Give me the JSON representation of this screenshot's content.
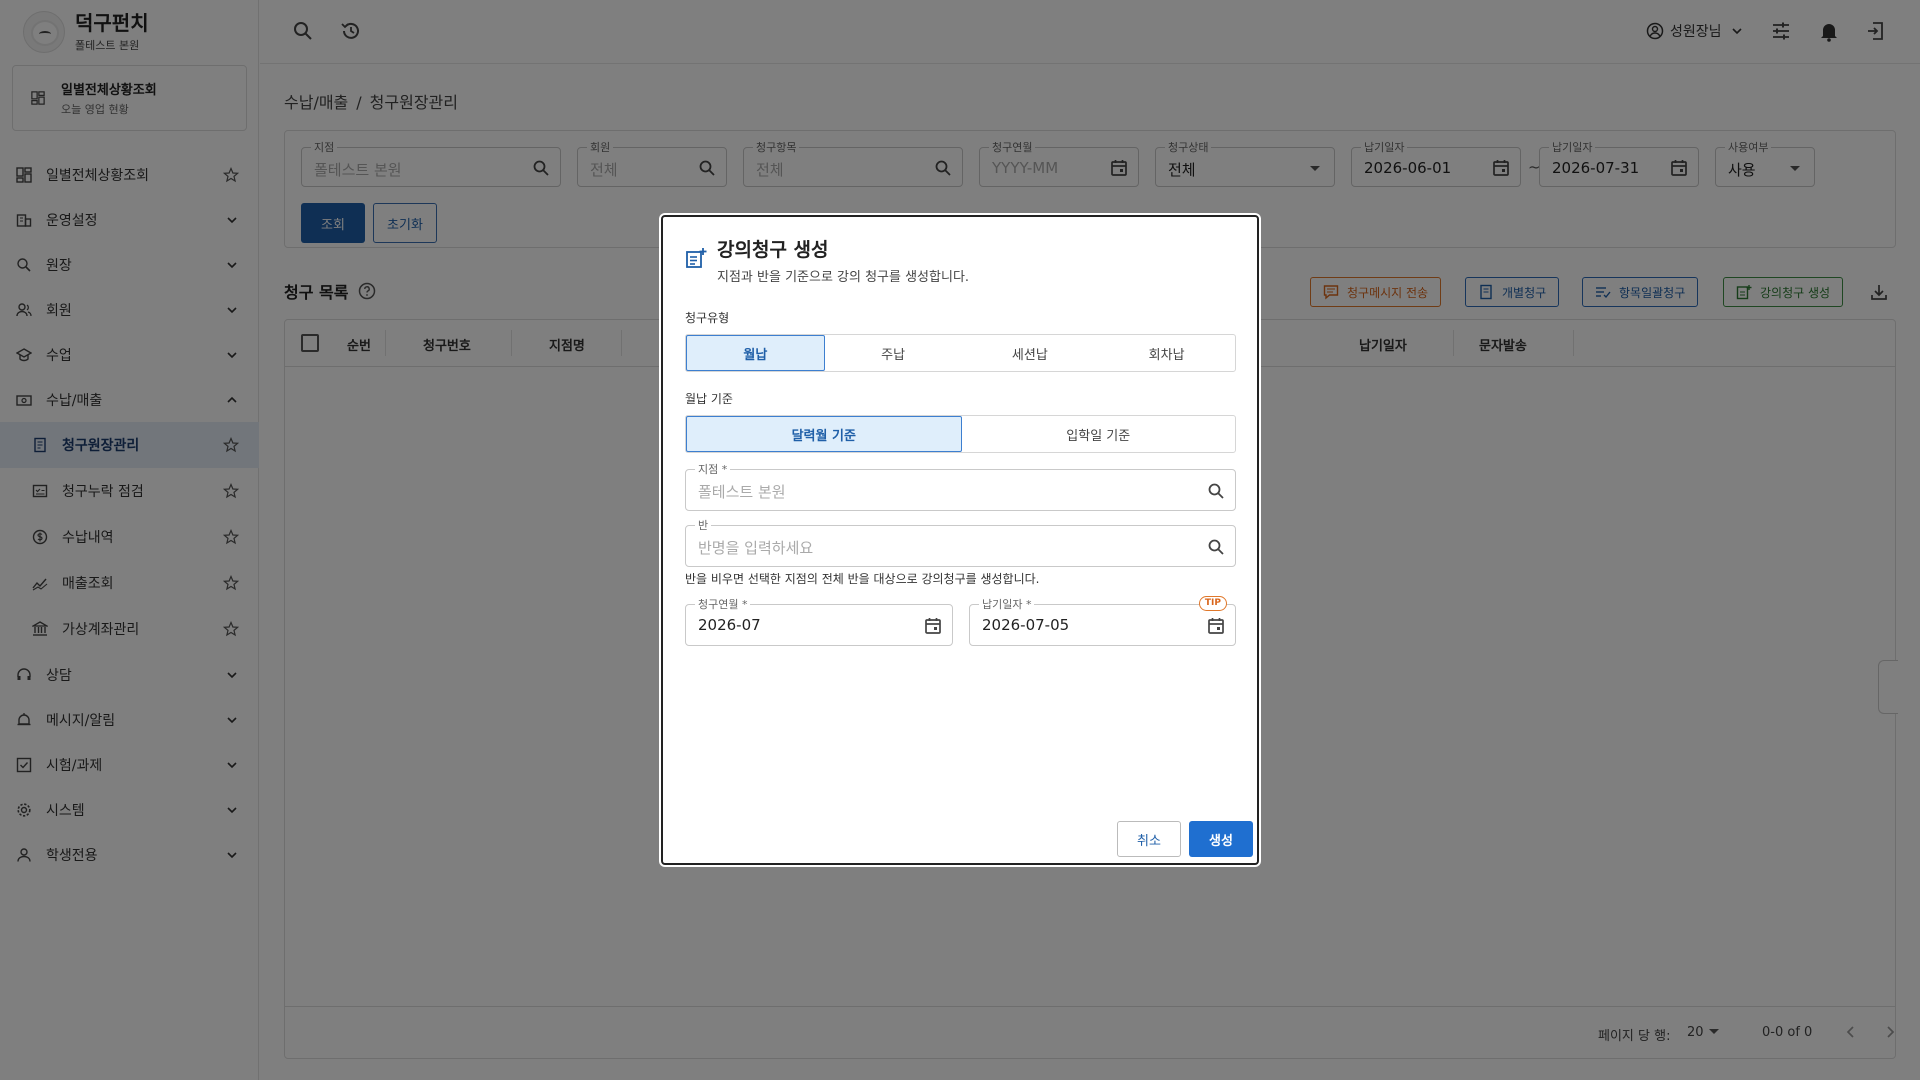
{
  "brand": {
    "title": "덕구펀치",
    "subtitle": "폴테스트 본원"
  },
  "summary_card": {
    "title": "일별전체상황조회",
    "subtitle": "오늘 영업 현황"
  },
  "sidebar": {
    "items": [
      {
        "label": "일별전체상황조회",
        "icon": "dashboard-icon",
        "trail": "star"
      },
      {
        "label": "운영설정",
        "icon": "building-icon",
        "trail": "chevron-down"
      },
      {
        "label": "원장",
        "icon": "user-search-icon",
        "trail": "chevron-down"
      },
      {
        "label": "회원",
        "icon": "users-icon",
        "trail": "chevron-down"
      },
      {
        "label": "수업",
        "icon": "school-icon",
        "trail": "chevron-down"
      },
      {
        "label": "수납/매출",
        "icon": "money-icon",
        "trail": "chevron-up"
      }
    ],
    "subitems": [
      {
        "label": "청구원장관리",
        "icon": "ledger-icon",
        "active": true
      },
      {
        "label": "청구누락 점검",
        "icon": "check-list-icon",
        "active": false
      },
      {
        "label": "수납내역",
        "icon": "coin-icon",
        "active": false
      },
      {
        "label": "매출조회",
        "icon": "chart-icon",
        "active": false
      },
      {
        "label": "가상계좌관리",
        "icon": "bank-icon",
        "active": false
      }
    ],
    "items_after": [
      {
        "label": "상담",
        "icon": "headset-icon"
      },
      {
        "label": "메시지/알림",
        "icon": "alarm-icon"
      },
      {
        "label": "시험/과제",
        "icon": "checkbox-icon"
      },
      {
        "label": "시스템",
        "icon": "gear-icon"
      },
      {
        "label": "학생전용",
        "icon": "person-icon"
      }
    ]
  },
  "topbar": {
    "user": "성원장님"
  },
  "breadcrumb": {
    "parent": "수납/매출",
    "sep": "/",
    "current": "청구원장관리"
  },
  "filters": {
    "branch": {
      "label": "지점",
      "placeholder": "폴테스트 본원"
    },
    "member": {
      "label": "회원",
      "placeholder": "전체"
    },
    "item": {
      "label": "청구항목",
      "placeholder": "전체"
    },
    "month": {
      "label": "청구연월",
      "placeholder": "YYYY-MM"
    },
    "status": {
      "label": "청구상태",
      "value": "전체"
    },
    "due_from": {
      "label": "납기일자",
      "value": "2026-06-01"
    },
    "tilde": "~",
    "due_to": {
      "label": "납기일자",
      "value": "2026-07-31"
    },
    "use": {
      "label": "사용여부",
      "value": "사용"
    },
    "query_label": "조회",
    "reset_label": "초기화"
  },
  "list": {
    "title": "청구 목록",
    "actions": {
      "message": "청구메시지 전송",
      "individual": "개별청구",
      "bulk": "항목일괄청구",
      "lecture": "강의청구 생성"
    },
    "columns": [
      "순번",
      "청구번호",
      "지점명",
      "납기일자",
      "문자발송"
    ],
    "footer": {
      "rows_per_page_label": "페이지 당 행:",
      "rows_per_page": "20",
      "range": "0-0 of 0"
    }
  },
  "modal": {
    "title": "강의청구 생성",
    "subtitle": "지점과 반을 기준으로 강의 청구를 생성합니다.",
    "type_label": "청구유형",
    "types": [
      "월납",
      "주납",
      "세션납",
      "회차납"
    ],
    "type_selected": 0,
    "basis_label": "월납 기준",
    "bases": [
      "달력월 기준",
      "입학일 기준"
    ],
    "basis_selected": 0,
    "branch": {
      "label": "지점 *",
      "placeholder": "폴테스트 본원"
    },
    "class": {
      "label": "반",
      "placeholder": "반명을 입력하세요"
    },
    "help": "반을 비우면 선택한 지점의 전체 반을 대상으로 강의청구를 생성합니다.",
    "month": {
      "label": "청구연월 *",
      "value": "2026-07"
    },
    "due": {
      "label": "납기일자 *",
      "value": "2026-07-05",
      "tip": "TIP"
    },
    "cancel_label": "취소",
    "submit_label": "생성"
  },
  "colors": {
    "primary": "#1f6fd0",
    "orange": "#e0782b",
    "green": "#3f8f44",
    "active_bg": "#e4ecf7"
  }
}
